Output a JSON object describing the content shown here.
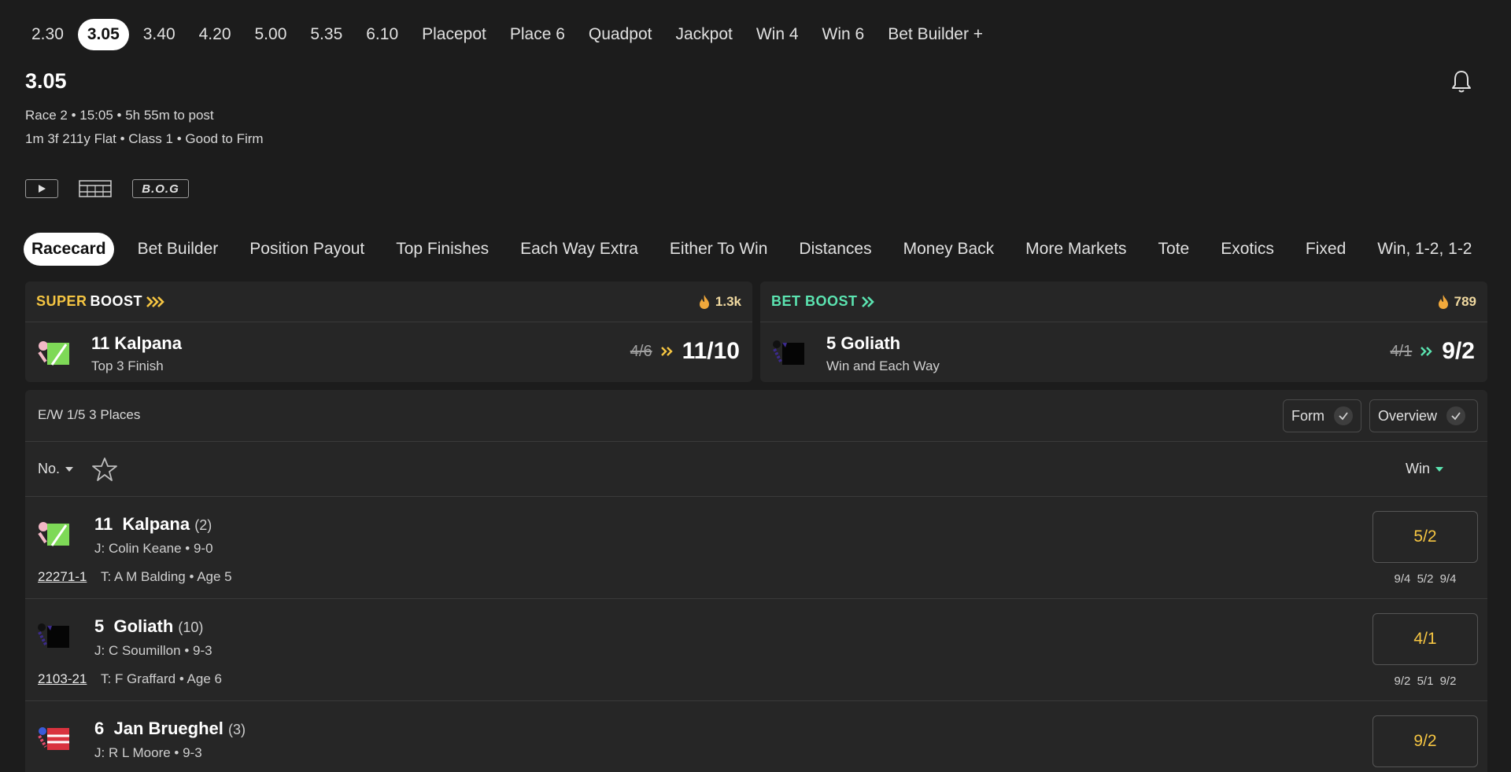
{
  "race_tabs": [
    {
      "label": "2.30"
    },
    {
      "label": "3.05",
      "active": true
    },
    {
      "label": "3.40"
    },
    {
      "label": "4.20"
    },
    {
      "label": "5.00"
    },
    {
      "label": "5.35"
    },
    {
      "label": "6.10"
    },
    {
      "label": "Placepot"
    },
    {
      "label": "Place 6"
    },
    {
      "label": "Quadpot"
    },
    {
      "label": "Jackpot"
    },
    {
      "label": "Win 4"
    },
    {
      "label": "Win 6"
    },
    {
      "label": "Bet Builder +"
    }
  ],
  "race": {
    "title": "3.05",
    "meta": "Race 2 • 15:05 • 5h 55m to post",
    "meta2": "1m 3f 211y Flat  • Class 1  • Good to Firm",
    "bog": "B.O.G"
  },
  "market_tabs": [
    {
      "label": "Racecard",
      "active": true
    },
    {
      "label": "Bet Builder"
    },
    {
      "label": "Position Payout"
    },
    {
      "label": "Top Finishes"
    },
    {
      "label": "Each Way Extra"
    },
    {
      "label": "Either To Win"
    },
    {
      "label": "Distances"
    },
    {
      "label": "Money Back"
    },
    {
      "label": "More Markets"
    },
    {
      "label": "Tote"
    },
    {
      "label": "Exotics"
    },
    {
      "label": "Fixed"
    },
    {
      "label": "Win, 1-2, 1-2"
    }
  ],
  "boosts": {
    "super": {
      "label_a": "SUPER",
      "label_b": "BOOST",
      "count": "1.3k",
      "name": "11   Kalpana",
      "sub": "Top 3 Finish",
      "old_odds": "4/6",
      "new_odds": "11/10"
    },
    "bet": {
      "label_a": "BET BOOST",
      "count": "789",
      "name": "5   Goliath",
      "sub": "Win and Each Way",
      "old_odds": "4/1",
      "new_odds": "9/2"
    }
  },
  "racecard": {
    "ew_terms": "E/W 1/5 3 Places",
    "form_toggle": "Form",
    "overview_toggle": "Overview",
    "sort_no": "No.",
    "sort_win": "Win",
    "runners": [
      {
        "no": "11",
        "name": "Kalpana",
        "draw": "(2)",
        "jockey": "J: Colin Keane • 9-0",
        "form": "22271-1",
        "trainer": "T: A M Balding • Age 5",
        "odds": "5/2",
        "history": "9/4 5/2 9/4",
        "silk": "green"
      },
      {
        "no": "5",
        "name": "Goliath",
        "draw": "(10)",
        "jockey": "J: C Soumillon • 9-3",
        "form": "2103-21",
        "trainer": "T: F Graffard • Age 6",
        "odds": "4/1",
        "history": "9/2 5/1 9/2",
        "silk": "black"
      },
      {
        "no": "6",
        "name": "Jan Brueghel",
        "draw": "(3)",
        "jockey": "J: R L Moore • 9-3",
        "form": "",
        "trainer": "",
        "odds": "9/2",
        "history": "",
        "silk": "red"
      }
    ]
  },
  "colors": {
    "background": "#1c1c1c",
    "card": "#262626",
    "odds_text": "#f5c542",
    "super_boost": "#f5c542",
    "bet_boost": "#5be3b0"
  }
}
